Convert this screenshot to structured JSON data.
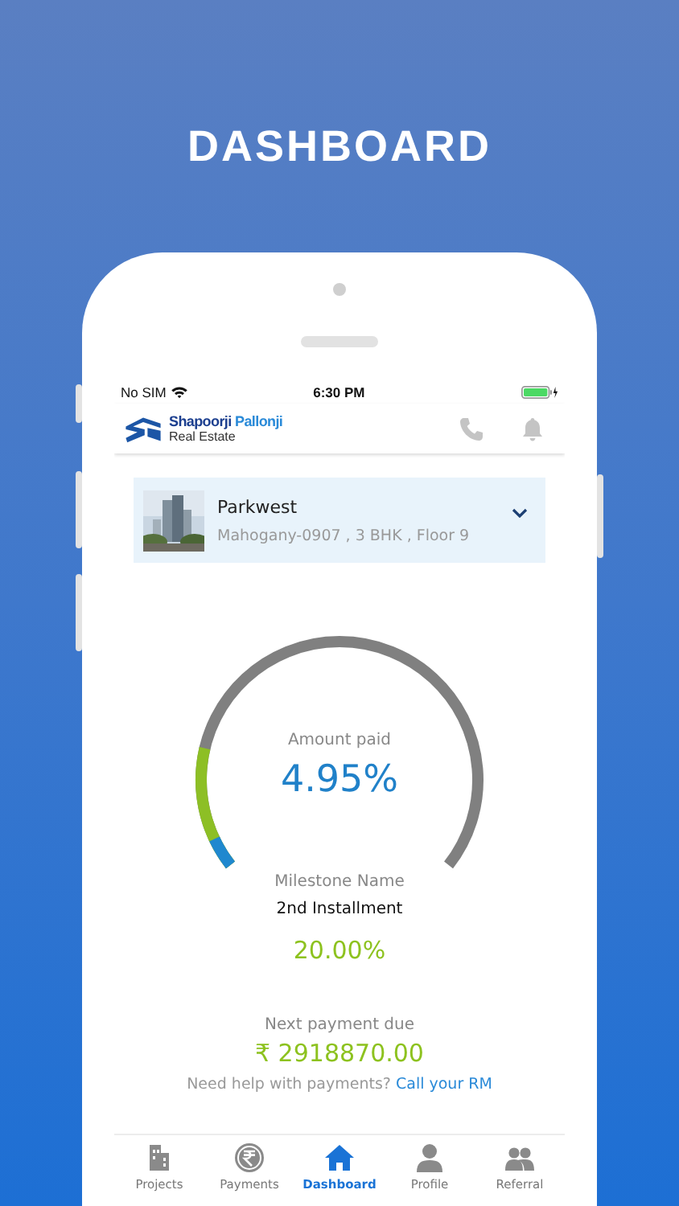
{
  "heading": "DASHBOARD",
  "status_bar": {
    "carrier": "No SIM",
    "time": "6:30 PM"
  },
  "header": {
    "brand_primary": "Shapoorji",
    "brand_secondary": "Pallonji",
    "subtitle": "Real Estate"
  },
  "property": {
    "name": "Parkwest",
    "details": "Mahogany-0907 , 3 BHK , Floor 9"
  },
  "amount_paid": {
    "label": "Amount paid",
    "value": "4.95%"
  },
  "milestone": {
    "label": "Milestone Name",
    "name": "2nd Installment",
    "value": "20.00%"
  },
  "next_payment": {
    "label": "Next payment due",
    "amount": "₹ 2918870.00"
  },
  "help": {
    "text": "Need help with payments?",
    "link": "Call your RM"
  },
  "tabs": [
    {
      "label": "Projects",
      "selected": false
    },
    {
      "label": "Payments",
      "selected": false
    },
    {
      "label": "Dashboard",
      "selected": true
    },
    {
      "label": "Profile",
      "selected": false
    },
    {
      "label": "Referral",
      "selected": false
    }
  ]
}
